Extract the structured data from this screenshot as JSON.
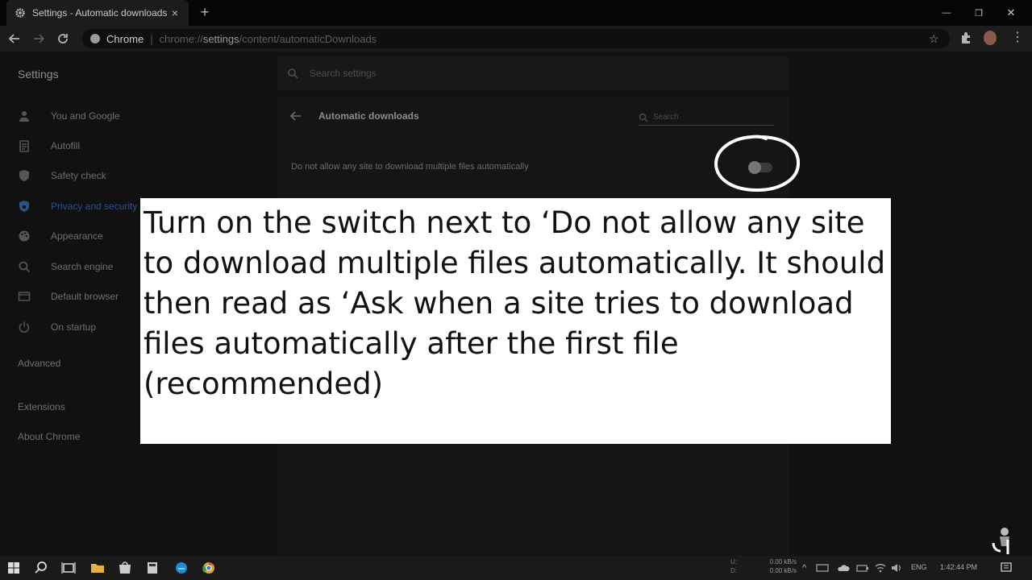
{
  "browser": {
    "tab_title": "Settings - Automatic downloads",
    "tab_close": "×",
    "new_tab": "+",
    "window_controls": {
      "minimize": "—",
      "restore": "❐",
      "close": "✕"
    },
    "omnibox": {
      "origin": "Chrome",
      "url_scheme": "chrome://",
      "url_host": "settings",
      "url_path": "/content/automaticDownloads"
    }
  },
  "settings": {
    "title": "Settings",
    "search_placeholder": "Search settings",
    "sidebar": [
      {
        "label": "You and Google",
        "icon": "person-icon"
      },
      {
        "label": "Autofill",
        "icon": "clipboard-icon"
      },
      {
        "label": "Safety check",
        "icon": "shield-icon"
      },
      {
        "label": "Privacy and security",
        "icon": "shield-lock-icon",
        "active": true
      },
      {
        "label": "Appearance",
        "icon": "palette-icon"
      },
      {
        "label": "Search engine",
        "icon": "search-icon"
      },
      {
        "label": "Default browser",
        "icon": "browser-window-icon"
      },
      {
        "label": "On startup",
        "icon": "power-icon"
      }
    ],
    "advanced": "Advanced",
    "extensions": "Extensions",
    "about": "About Chrome"
  },
  "page": {
    "heading": "Automatic downloads",
    "search_placeholder": "Search",
    "setting_label": "Do not allow any site to download multiple files automatically",
    "toggle_on": false
  },
  "caption": {
    "text": "Turn on the switch next to ‘Do not allow any site to download multiple files automatically. It should then read as ‘Ask when a site tries to download files automatically after the first file (recommended)"
  },
  "taskbar": {
    "net_up_label": "U:",
    "net_down_label": "D:",
    "net_up": "0.00 kB/s",
    "net_down": "0.00 kB/s",
    "language": "ENG",
    "time": "1:42:44 PM"
  },
  "colors": {
    "accent_active": "#2d4f8a",
    "caption_bg": "#ffffff"
  }
}
